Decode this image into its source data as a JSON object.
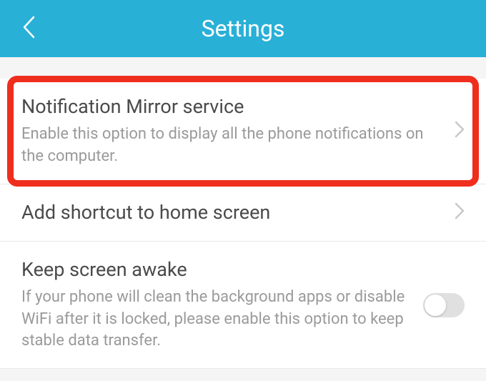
{
  "header": {
    "title": "Settings"
  },
  "items": [
    {
      "title": "Notification Mirror service",
      "subtitle": "Enable this option to display all the phone notifications on the computer."
    },
    {
      "title": "Add shortcut to home screen"
    },
    {
      "title": "Keep screen awake",
      "subtitle": "If your phone will clean the background apps or disable WiFi after it is locked, please enable this option to keep stable data transfer."
    }
  ]
}
